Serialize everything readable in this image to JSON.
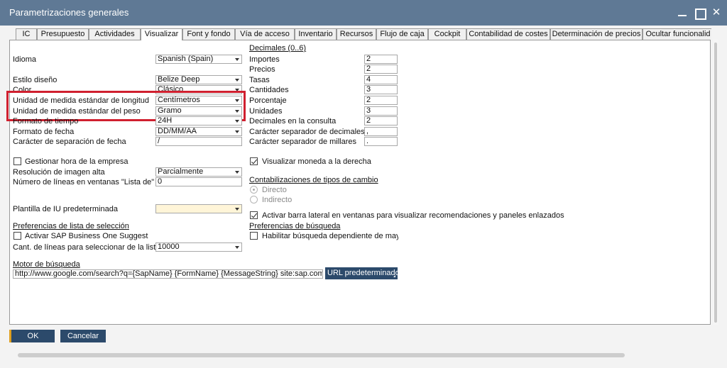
{
  "window": {
    "title": "Parametrizaciones generales"
  },
  "tabs": [
    {
      "label": "IC"
    },
    {
      "label": "Presupuesto"
    },
    {
      "label": "Actividades"
    },
    {
      "label": "Visualizar"
    },
    {
      "label": "Font y fondo"
    },
    {
      "label": "Vía de acceso"
    },
    {
      "label": "Inventario"
    },
    {
      "label": "Recursos"
    },
    {
      "label": "Flujo de caja"
    },
    {
      "label": "Cockpit"
    },
    {
      "label": "Contabilidad de costes"
    },
    {
      "label": "Determinación de precios"
    },
    {
      "label": "Ocultar funcionalid"
    }
  ],
  "left": {
    "idioma": {
      "label": "Idioma",
      "value": "Spanish (Spain)"
    },
    "estilo": {
      "label": "Estilo diseño",
      "value": "Belize Deep"
    },
    "color": {
      "label": "Color",
      "value": "Clásico"
    },
    "longitud": {
      "label": "Unidad de medida estándar de longitud",
      "value": "Centímetros"
    },
    "peso": {
      "label": "Unidad de medida estándar del peso",
      "value": "Gramo"
    },
    "tiempo": {
      "label": "Formato de tiempo",
      "value": "24H"
    },
    "fecha": {
      "label": "Formato de fecha",
      "value": "DD/MM/AA"
    },
    "separacion": {
      "label": "Carácter de separación de fecha",
      "value": "/"
    },
    "gestionar_hora": {
      "label": "Gestionar hora de la empresa"
    },
    "resolucion": {
      "label": "Resolución de imagen alta",
      "value": "Parcialmente"
    },
    "num_lineas": {
      "label": "Número de líneas en ventanas \"Lista de\"",
      "value": "0"
    },
    "plantilla": {
      "label": "Plantilla de IU predeterminada",
      "value": ""
    },
    "pref_lista": {
      "label": "Preferencias de lista de selección"
    },
    "suggest": {
      "label": "Activar SAP Business One Suggest"
    },
    "cant_lineas": {
      "label": "Cant. de líneas para seleccionar de la lista",
      "value": "10000"
    },
    "motor": {
      "label": "Motor de búsqueda",
      "value": "http://www.google.com/search?q={SapName} {FormName} {MessageString} site:sap.com"
    },
    "url_button": "URL predeterminado"
  },
  "right": {
    "decimales_title": "Decimales  (0..6)",
    "importes": {
      "label": "Importes",
      "value": "2"
    },
    "precios": {
      "label": "Precios",
      "value": "2"
    },
    "tasas": {
      "label": "Tasas",
      "value": "4"
    },
    "cantidades": {
      "label": "Cantidades",
      "value": "3"
    },
    "porcentaje": {
      "label": "Porcentaje",
      "value": "2"
    },
    "unidades": {
      "label": "Unidades",
      "value": "3"
    },
    "consulta": {
      "label": "Decimales en la consulta",
      "value": "2"
    },
    "sep_decimales": {
      "label": "Carácter separador de decimales",
      "value": ","
    },
    "sep_millares": {
      "label": "Carácter separador de millares",
      "value": "."
    },
    "moneda_derecha": {
      "label": "Visualizar moneda a la derecha"
    },
    "contab_title": "Contabilizaciones de tipos de cambio",
    "directo": {
      "label": "Directo"
    },
    "indirecto": {
      "label": "Indirecto"
    },
    "barra_lateral": {
      "label": "Activar barra lateral en ventanas para visualizar recomendaciones y paneles enlazados"
    },
    "pref_busqueda": {
      "label": "Preferencias de búsqueda"
    },
    "mayus": {
      "label": "Habilitar búsqueda dependiente de mayús"
    }
  },
  "buttons": {
    "ok": "OK",
    "cancel": "Cancelar"
  },
  "colors": {
    "titlebar": "#5f7995",
    "button": "#2c4a6b",
    "highlight": "#d0202f"
  }
}
